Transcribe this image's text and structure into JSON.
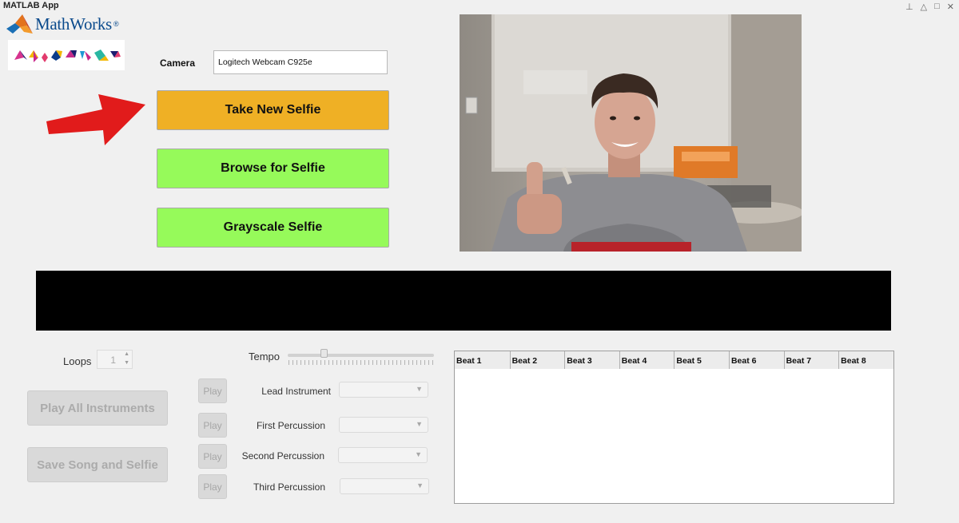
{
  "window": {
    "title": "MATLAB App",
    "controls": [
      "pin-icon",
      "minimize-icon",
      "maximize-icon",
      "close-icon"
    ]
  },
  "logo": {
    "brand": "MathWorks",
    "mark": "®"
  },
  "camera": {
    "label": "Camera",
    "value": "Logitech Webcam C925e"
  },
  "buttons": {
    "take_selfie": "Take New Selfie",
    "browse_selfie": "Browse for Selfie",
    "grayscale_selfie": "Grayscale Selfie",
    "play_all": "Play All Instruments",
    "save_song": "Save Song and Selfie"
  },
  "colors": {
    "take_selfie_bg": "#efb025",
    "selfie_buttons_bg": "#96fa5a",
    "pointer_arrow": "#e11b1b"
  },
  "loops": {
    "label": "Loops",
    "value": "1"
  },
  "tempo": {
    "label": "Tempo",
    "level": 0.25
  },
  "instruments": [
    {
      "label": "Lead Instrument",
      "play": "Play",
      "selected": ""
    },
    {
      "label": "First Percussion",
      "play": "Play",
      "selected": ""
    },
    {
      "label": "Second Percussion",
      "play": "Play",
      "selected": ""
    },
    {
      "label": "Third Percussion",
      "play": "Play",
      "selected": ""
    }
  ],
  "beats": [
    "Beat 1",
    "Beat 2",
    "Beat 3",
    "Beat 4",
    "Beat 5",
    "Beat 6",
    "Beat 7",
    "Beat 8"
  ]
}
